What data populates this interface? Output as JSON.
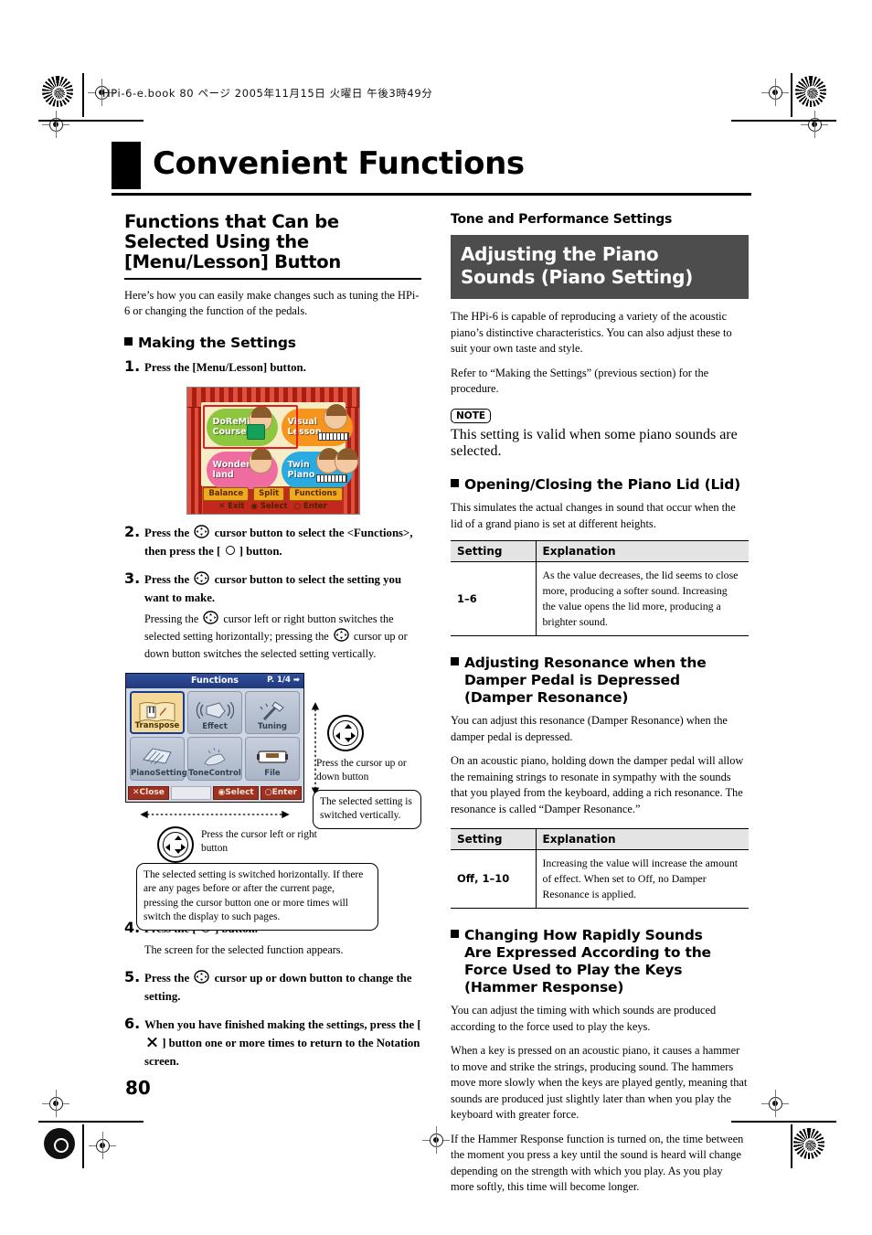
{
  "print_marks": {
    "file_header": "HPi-6-e.book 80 ページ 2005年11月15日 火曜日 午後3時49分"
  },
  "chapter": {
    "title": "Convenient Functions"
  },
  "page_number": "80",
  "left_column": {
    "section_title": "Functions that Can be Selected Using the [Menu/Lesson] Button",
    "intro": "Here’s how you can easily make changes such as tuning the HPi-6 or changing the function of the pedals.",
    "sub_heading": "Making the Settings",
    "steps": [
      {
        "num": "1.",
        "text_a": "Press the [Menu/Lesson] button."
      },
      {
        "num": "2.",
        "text_a": "Press the ",
        "text_b": " cursor button to select the <Functions>, then press the [ ",
        "text_c": " ] button."
      },
      {
        "num": "3.",
        "text_a": "Press the ",
        "text_b": " cursor button to select the setting you want to make.",
        "note_a": "Pressing the ",
        "note_b": " cursor left or right button switches the selected setting horizontally; pressing the ",
        "note_c": " cursor up or down button switches the selected setting vertically."
      },
      {
        "num": "4.",
        "text_a": "Press the [ ",
        "text_b": " ] button.",
        "note_a": "The screen for the selected function appears."
      },
      {
        "num": "5.",
        "text_a": "Press the ",
        "text_b": " cursor up or down button to change the setting."
      },
      {
        "num": "6.",
        "text_a": "When you have finished making the settings, press the [ ",
        "text_b": " ] button one or more times to return to the Notation screen."
      }
    ],
    "menu_screen": {
      "tiles": [
        {
          "label_line1": "DoReMi",
          "label_line2": "Course",
          "color": "#8dc63f",
          "selected": true
        },
        {
          "label_line1": "Visual",
          "label_line2": "Lesson",
          "color": "#f7941e",
          "selected": false
        },
        {
          "label_line1": "Wonder-",
          "label_line2": "land",
          "color": "#ef6ca0",
          "selected": false
        },
        {
          "label_line1": "Twin",
          "label_line2": "Piano",
          "color": "#29abe2",
          "selected": false
        }
      ],
      "buttons": [
        "Balance",
        "Split",
        "Functions"
      ],
      "legend": [
        "Exit",
        "Select",
        "Enter"
      ]
    },
    "functions_screen": {
      "title": "Functions",
      "page_indicator": "P. 1/4",
      "cells": [
        {
          "label": "Transpose",
          "icon": "book-piano-violin-icon",
          "active": true
        },
        {
          "label": "Effect",
          "icon": "speaker-waves-icon",
          "active": false
        },
        {
          "label": "Tuning",
          "icon": "tuning-fork-icon",
          "active": false
        },
        {
          "label": "PianoSetting",
          "icon": "grand-piano-icon",
          "active": false
        },
        {
          "label": "ToneControl",
          "icon": "tone-control-icon",
          "active": false
        },
        {
          "label": "File",
          "icon": "floppy-disk-icon",
          "active": false
        }
      ],
      "bottom_buttons": [
        "Close",
        "Select",
        "Enter"
      ]
    },
    "annotations": {
      "vertical_label": "Press the cursor up or down button",
      "vertical_callout": "The selected setting is switched vertically.",
      "horizontal_label": "Press the cursor left or right button",
      "horizontal_callout": "The selected setting is switched horizontally. If there are any pages before or after the current page, pressing the cursor button one or more times will switch the display to such pages."
    }
  },
  "right_column": {
    "kicker": "Tone and Performance Settings",
    "banner_title": "Adjusting the Piano Sounds (Piano Setting)",
    "intro_1": "The HPi-6 is capable of reproducing a variety of the acoustic piano’s distinctive characteristics. You can also adjust these to suit your own taste and style.",
    "intro_2": "Refer to “Making the Settings” (previous section) for the procedure.",
    "note_badge": "NOTE",
    "note_text": "This setting is valid when some piano sounds are selected.",
    "sections": [
      {
        "heading": "Opening/Closing the Piano Lid (Lid)",
        "paragraphs": [
          "This simulates the actual changes in sound that occur when the lid of a grand piano is set at different heights."
        ],
        "table": {
          "headers": [
            "Setting",
            "Explanation"
          ],
          "rows": [
            [
              "1–6",
              "As the value decreases, the lid seems to close more, producing a softer sound. Increasing the value opens the lid more, producing a brighter sound."
            ]
          ]
        }
      },
      {
        "heading": "Adjusting Resonance when the Damper Pedal is Depressed (Damper Resonance)",
        "paragraphs": [
          "You can adjust this resonance (Damper Resonance) when the damper pedal is depressed.",
          "On an acoustic piano, holding down the damper pedal will allow the remaining strings to resonate in sympathy with the sounds that you played from the keyboard, adding a rich resonance. The resonance is called “Damper Resonance.”"
        ],
        "table": {
          "headers": [
            "Setting",
            "Explanation"
          ],
          "rows": [
            [
              "Off, 1–10",
              "Increasing the value will increase the amount of effect. When set to Off, no Damper Resonance is applied."
            ]
          ]
        }
      },
      {
        "heading": "Changing How Rapidly Sounds Are Expressed According to the Force Used to Play the Keys (Hammer Response)",
        "paragraphs": [
          "You can adjust the timing with which sounds are produced according to the force used to play the keys.",
          "When a key is pressed on an acoustic piano, it causes a hammer to move and strike the strings, producing sound. The hammers move more slowly when the keys are played gently, meaning that sounds are produced just slightly later than when you play the keyboard with greater force.",
          "If the Hammer Response function is turned on, the time between the moment you press a key until the sound is heard will change depending on the strength with which you play. As you play more softly, this time will become longer."
        ]
      }
    ]
  }
}
